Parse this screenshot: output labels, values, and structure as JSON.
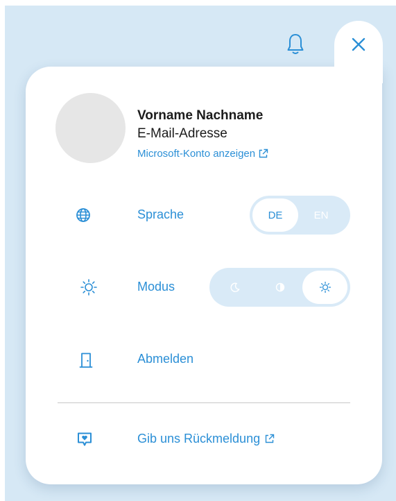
{
  "header": {
    "bell_icon": "bell-icon",
    "close_icon": "close-icon"
  },
  "profile": {
    "name": "Vorname Nachname",
    "email": "E-Mail-Adresse",
    "account_link": "Microsoft-Konto anzeigen"
  },
  "menu": {
    "language": {
      "label": "Sprache",
      "icon": "globe-icon",
      "options": [
        "DE",
        "EN"
      ],
      "selected": "DE"
    },
    "mode": {
      "label": "Modus",
      "icon": "sun-icon",
      "options": [
        "dark",
        "contrast",
        "light"
      ],
      "selected": "light"
    },
    "logout": {
      "label": "Abmelden",
      "icon": "door-icon"
    },
    "feedback": {
      "label": "Gib uns Rückmeldung",
      "icon": "feedback-heart-icon"
    }
  },
  "colors": {
    "accent": "#2b8fd6",
    "backdrop": "#d6e8f5",
    "toggle_bg": "#d9eaf7"
  }
}
